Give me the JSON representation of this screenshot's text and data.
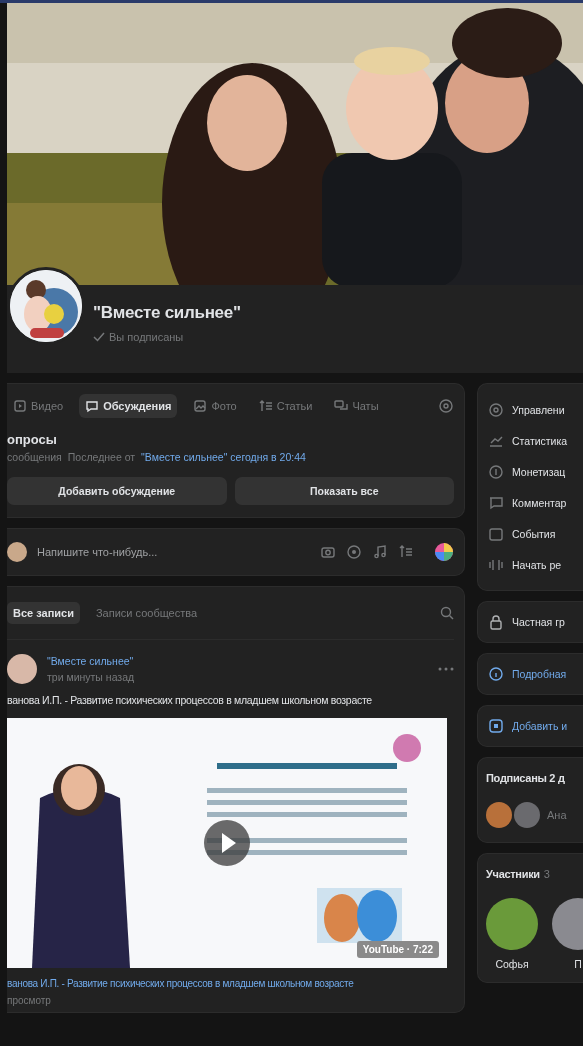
{
  "community": {
    "name": "\"Вместе сильнее\"",
    "status": "Вы подписаны",
    "subscribed": true
  },
  "tabs": [
    {
      "label": "Видео",
      "selected": false
    },
    {
      "label": "Обсуждения",
      "selected": true
    },
    {
      "label": "Фото",
      "selected": false
    },
    {
      "label": "Статьи",
      "selected": false
    },
    {
      "label": "Чаты",
      "selected": false
    }
  ],
  "discussion": {
    "title": "опросы",
    "count": "сообщения",
    "last_prefix": "Последнее от",
    "last_link": "\"Вместе сильнее\" сегодня в 20:44"
  },
  "discussion_buttons": [
    "Добавить обсуждение",
    "Показать все"
  ],
  "composer": {
    "placeholder": "Напишите что-нибудь..."
  },
  "feed_filters": [
    {
      "label": "Все записи",
      "selected": true
    },
    {
      "label": "Записи сообщества",
      "selected": false
    }
  ],
  "post": {
    "author": "\"Вместе сильнее\"",
    "time": "три минуты назад",
    "text": "ванова И.П. - Развитие психических процессов в младшем школьном возрасте",
    "video": {
      "kind": "picture",
      "badge": "YouTube · 7:22"
    },
    "caption": "ванова И.П. - Развитие психических процессов в младшем школьном возрасте",
    "views": "просмотр"
  },
  "admin_menu": [
    "Управлени",
    "Статистика",
    "Монетизац",
    "Комментар",
    "События",
    "Начать ре"
  ],
  "privacy": "Частная гр",
  "info_link": "Подробная",
  "add_link": "Добавить и",
  "friends": {
    "title": "Подписаны 2 д",
    "names": "Ана"
  },
  "members": {
    "title": "Участники",
    "count": "3",
    "people": [
      {
        "name": "Софья"
      },
      {
        "name": "П"
      }
    ]
  }
}
